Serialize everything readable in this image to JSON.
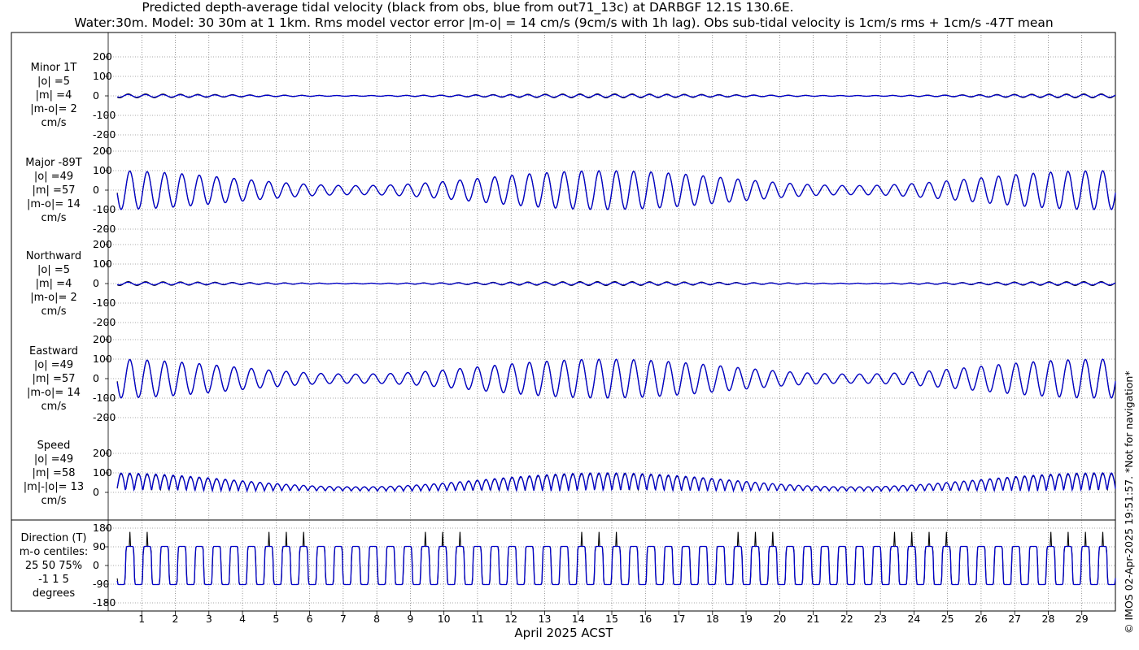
{
  "title_lines": [
    "Predicted depth-average tidal velocity (black from obs, blue from out71_13c) at DARBGF 12.1S 130.6E.",
    "Water:30m. Model: 30 30m at 1 1km. Rms model vector error |m-o| = 14 cm/s (9cm/s with 1h lag). Obs sub-tidal velocity is 1cm/s rms + 1cm/s -47T mean"
  ],
  "credit": "© IMOS 02-Apr-2025 19:51:57. *Not for navigation*",
  "colors": {
    "obs": "#000000",
    "model": "#0000cc",
    "grid": "#555555"
  },
  "chart_data": {
    "type": "line",
    "xlabel": "April 2025 ACST",
    "x_range_days": [
      0,
      30
    ],
    "x_ticks": [
      1,
      2,
      3,
      4,
      5,
      6,
      7,
      8,
      9,
      10,
      11,
      12,
      13,
      14,
      15,
      16,
      17,
      18,
      19,
      20,
      21,
      22,
      23,
      24,
      25,
      26,
      27,
      28,
      29
    ],
    "grid": true,
    "series_names": [
      "obs",
      "model"
    ],
    "tidal_envelope_note": "spring-neap modulation; spring tides near Apr 1-2, 13-15, 28-29; neap near Apr 6-7 and Apr 21-22",
    "panels": [
      {
        "id": "minor",
        "label_lines": [
          "Minor 1T",
          "|o| =5",
          "|m| =4",
          "|m-o|= 2",
          "cm/s"
        ],
        "ylim": [
          -200,
          200
        ],
        "yticks": [
          -200,
          -100,
          0,
          100,
          200
        ],
        "obs_amp": 5,
        "model_amp": 4
      },
      {
        "id": "major",
        "label_lines": [
          "Major -89T",
          "|o| =49",
          "|m| =57",
          "|m-o|= 14",
          "cm/s"
        ],
        "ylim": [
          -200,
          200
        ],
        "yticks": [
          -200,
          -100,
          0,
          100,
          200
        ],
        "obs_amp": 49,
        "model_amp": 57
      },
      {
        "id": "northward",
        "label_lines": [
          "Northward",
          "|o| =5",
          "|m| =4",
          "|m-o|= 2",
          "cm/s"
        ],
        "ylim": [
          -200,
          200
        ],
        "yticks": [
          -200,
          -100,
          0,
          100,
          200
        ],
        "obs_amp": 5,
        "model_amp": 4
      },
      {
        "id": "eastward",
        "label_lines": [
          "Eastward",
          "|o| =49",
          "|m| =57",
          "|m-o|= 14",
          "cm/s"
        ],
        "ylim": [
          -200,
          200
        ],
        "yticks": [
          -200,
          -100,
          0,
          100,
          200
        ],
        "obs_amp": 49,
        "model_amp": 57
      },
      {
        "id": "speed",
        "label_lines": [
          "Speed",
          "|o| =49",
          "|m| =58",
          "|m|-|o|= 13",
          "cm/s"
        ],
        "ylim": [
          0,
          200
        ],
        "yticks": [
          0,
          100,
          200
        ],
        "obs_amp": 49,
        "model_amp": 58
      },
      {
        "id": "direction",
        "label_lines": [
          "Direction (T)",
          "m-o centiles:",
          "25  50  75%",
          "-1   1   5",
          "degrees"
        ],
        "ylim": [
          -180,
          180
        ],
        "yticks": [
          -180,
          -90,
          0,
          90,
          180
        ],
        "centiles": {
          "p25": -1,
          "p50": 1,
          "p75": 5
        }
      }
    ]
  }
}
